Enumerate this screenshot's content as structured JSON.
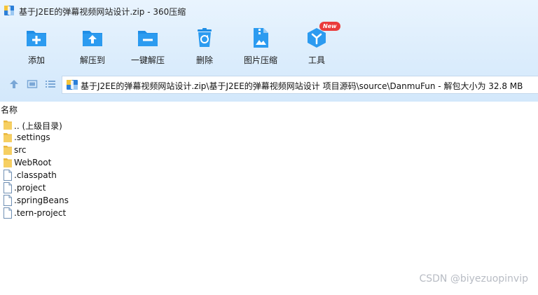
{
  "window": {
    "title": "基于J2EE的弹幕视频网站设计.zip - 360压缩"
  },
  "toolbar": {
    "add_label": "添加",
    "extract_label": "解压到",
    "oneclick_label": "一键解压",
    "delete_label": "删除",
    "image_compress_label": "图片压缩",
    "tools_label": "工具",
    "tools_badge": "New"
  },
  "address": {
    "path": "基于J2EE的弹幕视频网站设计.zip\\基于J2EE的弹幕视频网站设计 项目源码\\source\\DanmuFun - 解包大小为 32.8 MB"
  },
  "list": {
    "column_name": "名称",
    "items": [
      {
        "name": ".. (上级目录)",
        "kind": "folder"
      },
      {
        "name": ".settings",
        "kind": "folder"
      },
      {
        "name": "src",
        "kind": "folder"
      },
      {
        "name": "WebRoot",
        "kind": "folder"
      },
      {
        "name": ".classpath",
        "kind": "file"
      },
      {
        "name": ".project",
        "kind": "file"
      },
      {
        "name": ".springBeans",
        "kind": "file"
      },
      {
        "name": ".tern-project",
        "kind": "file"
      }
    ]
  },
  "watermark": "CSDN @biyezuopinvip",
  "colors": {
    "accent": "#1f8ee6",
    "folder": "#f6cf62",
    "badge": "#ea3c3c"
  }
}
